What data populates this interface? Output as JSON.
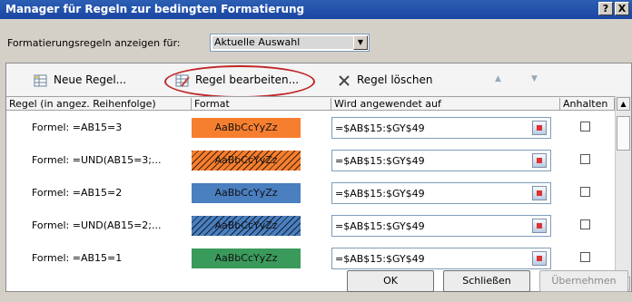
{
  "window": {
    "title": "Manager für Regeln zur bedingten Formatierung",
    "help_label": "?",
    "close_label": "X"
  },
  "show_rules": {
    "label": "Formatierungsregeln anzeigen für:",
    "value": "Aktuelle Auswahl"
  },
  "toolbar": {
    "new_label": "Neue Regel...",
    "edit_label": "Regel bearbeiten...",
    "delete_label": "Regel löschen",
    "move_up_icon": "arrow-up-icon",
    "move_down_icon": "arrow-down-icon",
    "highlight_color": "#c02528"
  },
  "columns": {
    "rule": "Regel (in angez. Reihenfolge)",
    "format": "Format",
    "applies": "Wird angewendet auf",
    "stop": "Anhalten"
  },
  "rules": [
    {
      "rule": "Formel: =AB15=3",
      "preview": "AaBbCcYyZz",
      "color": "#f67f2f",
      "hatched": false,
      "applies": "=$AB$15:$GY$49",
      "stop": false
    },
    {
      "rule": "Formel: =UND(AB15=3;...",
      "preview": "AaBbCcYyZz",
      "color": "#f67f2f",
      "hatched": true,
      "applies": "=$AB$15:$GY$49",
      "stop": false
    },
    {
      "rule": "Formel: =AB15=2",
      "preview": "AaBbCcYyZz",
      "color": "#4a7fc0",
      "hatched": false,
      "applies": "=$AB$15:$GY$49",
      "stop": false
    },
    {
      "rule": "Formel: =UND(AB15=2;...",
      "preview": "AaBbCcYyZz",
      "color": "#4a7fc0",
      "hatched": true,
      "applies": "=$AB$15:$GY$49",
      "stop": false
    },
    {
      "rule": "Formel: =AB15=1",
      "preview": "AaBbCcYyZz",
      "color": "#3a9a5c",
      "hatched": false,
      "applies": "=$AB$15:$GY$49",
      "stop": false
    }
  ],
  "buttons": {
    "ok": "OK",
    "close": "Schließen",
    "apply": "Übernehmen"
  }
}
